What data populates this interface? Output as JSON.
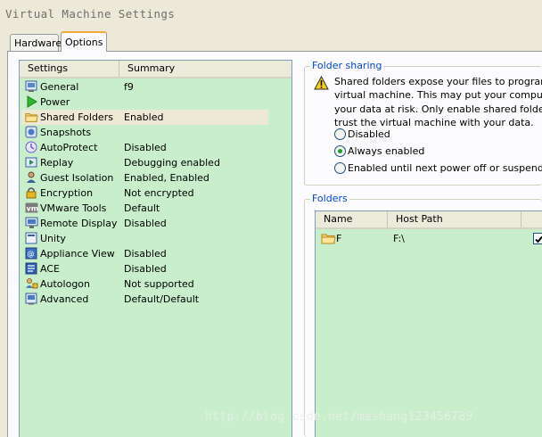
{
  "window": {
    "title": "Virtual Machine Settings"
  },
  "tabs": [
    {
      "label": "Hardware",
      "active": false
    },
    {
      "label": "Options",
      "active": true
    }
  ],
  "settings_list": {
    "headers": {
      "settings": "Settings",
      "summary": "Summary"
    },
    "rows": [
      {
        "name": "General",
        "summary": "f9",
        "icon": "general-icon"
      },
      {
        "name": "Power",
        "summary": "",
        "icon": "power-icon"
      },
      {
        "name": "Shared Folders",
        "summary": "Enabled",
        "icon": "folder-icon",
        "selected": true
      },
      {
        "name": "Snapshots",
        "summary": "",
        "icon": "snapshot-icon"
      },
      {
        "name": "AutoProtect",
        "summary": "Disabled",
        "icon": "autoprotect-icon"
      },
      {
        "name": "Replay",
        "summary": "Debugging enabled",
        "icon": "replay-icon"
      },
      {
        "name": "Guest Isolation",
        "summary": "Enabled, Enabled",
        "icon": "guest-isolation-icon"
      },
      {
        "name": "Encryption",
        "summary": "Not encrypted",
        "icon": "lock-icon"
      },
      {
        "name": "VMware Tools",
        "summary": "Default",
        "icon": "vmware-tools-icon"
      },
      {
        "name": "Remote Display",
        "summary": "Disabled",
        "icon": "remote-display-icon"
      },
      {
        "name": "Unity",
        "summary": "",
        "icon": "unity-icon"
      },
      {
        "name": "Appliance View",
        "summary": "Disabled",
        "icon": "appliance-view-icon"
      },
      {
        "name": "ACE",
        "summary": "Disabled",
        "icon": "ace-icon"
      },
      {
        "name": "Autologon",
        "summary": "Not supported",
        "icon": "autologon-icon"
      },
      {
        "name": "Advanced",
        "summary": "Default/Default",
        "icon": "advanced-icon"
      }
    ]
  },
  "folder_sharing": {
    "label": "Folder sharing",
    "warning_lines": [
      "Shared folders expose your files to programs in t",
      "virtual machine. This may put your computer and",
      "your data at risk. Only enable shared folders if y",
      "trust the virtual machine with your data."
    ],
    "options": [
      {
        "label": "Disabled",
        "checked": false
      },
      {
        "label": "Always enabled",
        "checked": true
      },
      {
        "label": "Enabled until next power off or suspend",
        "checked": false
      }
    ]
  },
  "folders": {
    "label": "Folders",
    "headers": {
      "name": "Name",
      "host_path": "Host Path"
    },
    "rows": [
      {
        "name": "F",
        "host_path": "F:\\",
        "enabled": true
      }
    ]
  },
  "watermark": "http://blog.csdn.net/mashang123456789",
  "colors": {
    "list_background": "#c9eecb",
    "selected_row": "#ede9d4",
    "group_label": "#0046d5",
    "tab_highlight": "#f4a73a"
  }
}
